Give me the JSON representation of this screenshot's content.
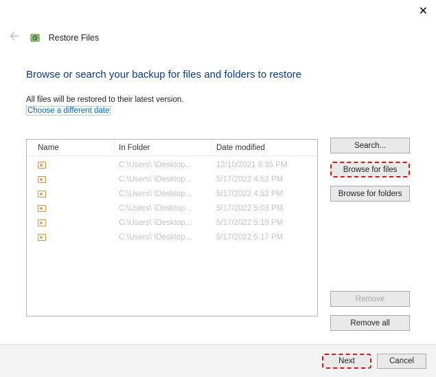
{
  "window": {
    "title": "Restore Files"
  },
  "heading": "Browse or search your backup for files and folders to restore",
  "subtext": "All files will be restored to their latest version.",
  "link": "Choose a different date",
  "columns": {
    "name": "Name",
    "folder": "In Folder",
    "date": "Date modified"
  },
  "rows": [
    {
      "folder": "C:\\Users\\        \\Desktop...",
      "date": "12/10/2021 6:35 PM"
    },
    {
      "folder": "C:\\Users\\        \\Desktop...",
      "date": "5/17/2022 4:52 PM"
    },
    {
      "folder": "C:\\Users\\        \\Desktop...",
      "date": "5/17/2022 4:52 PM"
    },
    {
      "folder": "C:\\Users\\        \\Desktop...",
      "date": "5/17/2022 5:03 PM"
    },
    {
      "folder": "C:\\Users\\        \\Desktop...",
      "date": "5/17/2022 5:19 PM"
    },
    {
      "folder": "C:\\Users\\        \\Desktop...",
      "date": "5/17/2022 5:17 PM"
    }
  ],
  "buttons": {
    "search": "Search...",
    "browse_files": "Browse for files",
    "browse_folders": "Browse for folders",
    "remove": "Remove",
    "remove_all": "Remove all",
    "next": "Next",
    "cancel": "Cancel"
  }
}
